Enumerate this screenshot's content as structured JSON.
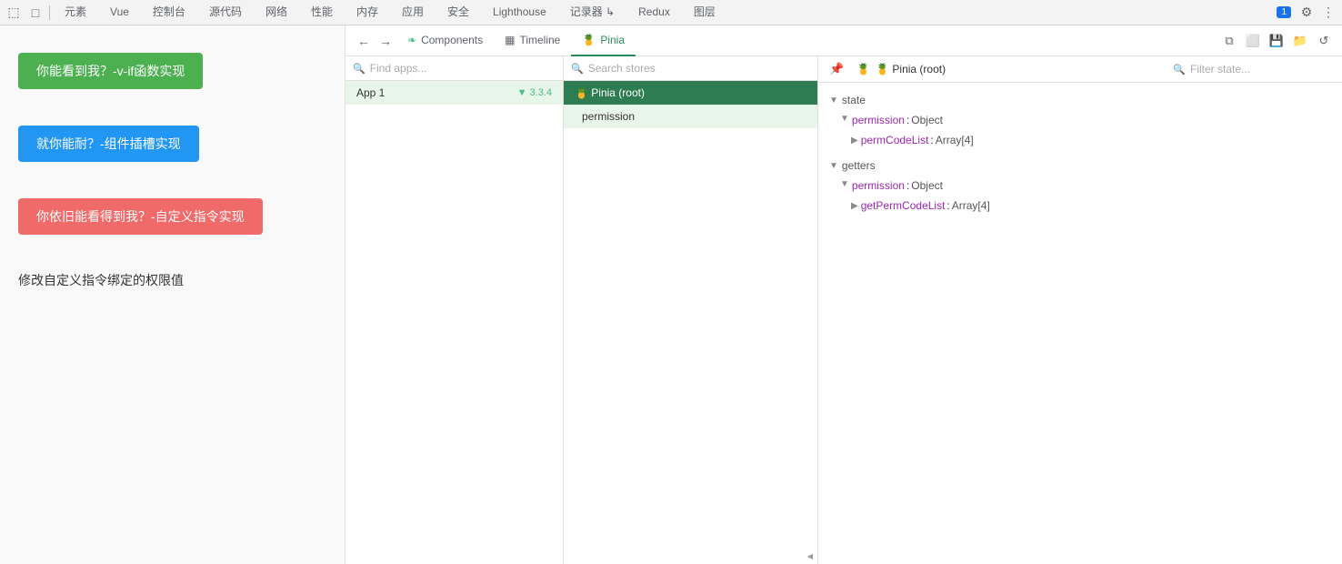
{
  "toolbar": {
    "tools": [
      {
        "name": "inspect-icon",
        "glyph": "⬚"
      },
      {
        "name": "device-icon",
        "glyph": "□"
      }
    ],
    "tabs": [
      {
        "label": "元素",
        "name": "elements-tab"
      },
      {
        "label": "Vue",
        "name": "vue-tab",
        "active": true
      },
      {
        "label": "控制台",
        "name": "console-tab"
      },
      {
        "label": "源代码",
        "name": "sources-tab"
      },
      {
        "label": "网络",
        "name": "network-tab"
      },
      {
        "label": "性能",
        "name": "performance-tab"
      },
      {
        "label": "内存",
        "name": "memory-tab"
      },
      {
        "label": "应用",
        "name": "application-tab"
      },
      {
        "label": "安全",
        "name": "security-tab"
      },
      {
        "label": "Lighthouse",
        "name": "lighthouse-tab"
      },
      {
        "label": "记录器 ↳",
        "name": "recorder-tab"
      },
      {
        "label": "Redux",
        "name": "redux-tab"
      },
      {
        "label": "图层",
        "name": "layers-tab"
      }
    ],
    "badge": "1",
    "settings_icon": "⚙",
    "more_icon": "⋮"
  },
  "vue_tabs": {
    "back_label": "←",
    "forward_label": "→",
    "items": [
      {
        "label": "Components",
        "icon": "❧",
        "name": "components-tab"
      },
      {
        "label": "Timeline",
        "icon": "▦",
        "name": "timeline-tab"
      },
      {
        "label": "Pinia",
        "icon": "🍍",
        "name": "pinia-tab",
        "active": true
      }
    ],
    "actions": [
      {
        "name": "copy-icon",
        "glyph": "⧉"
      },
      {
        "name": "duplicate-icon",
        "glyph": "⬜"
      },
      {
        "name": "save-icon",
        "glyph": "💾"
      },
      {
        "name": "folder-icon",
        "glyph": "📁"
      },
      {
        "name": "refresh-icon",
        "glyph": "↺"
      }
    ]
  },
  "apps_panel": {
    "search_placeholder": "Find apps...",
    "items": [
      {
        "label": "App 1",
        "vue_version": "3.3.4",
        "name": "app-1"
      }
    ]
  },
  "stores_panel": {
    "search_placeholder": "Search stores",
    "items": [
      {
        "label": "🍍 Pinia (root)",
        "type": "root",
        "selected": true,
        "name": "pinia-root-store"
      },
      {
        "label": "permission",
        "type": "sub",
        "name": "permission-store"
      }
    ]
  },
  "state_panel": {
    "store_title": "🍍 Pinia (root)",
    "filter_placeholder": "Filter state...",
    "sections": [
      {
        "label": "state",
        "name": "state-section",
        "items": [
          {
            "key": "permission",
            "colon": ":",
            "value": "Object",
            "expandable": true,
            "children": [
              {
                "key": "permCodeList",
                "colon": ":",
                "value": "Array[4]",
                "expandable": true
              }
            ]
          }
        ]
      },
      {
        "label": "getters",
        "name": "getters-section",
        "items": [
          {
            "key": "permission",
            "colon": ":",
            "value": "Object",
            "expandable": true,
            "children": [
              {
                "key": "getPermCodeList",
                "colon": ":",
                "value": "Array[4]",
                "expandable": true
              }
            ]
          }
        ]
      }
    ]
  },
  "app_viewport": {
    "btn1_label": "你能看到我？-v-if函数实现",
    "btn2_label": "就你能耐？-组件插槽实现",
    "btn3_label": "你依旧能看得到我？-自定义指令实现",
    "text1": "修改自定义指令绑定的权限值"
  }
}
